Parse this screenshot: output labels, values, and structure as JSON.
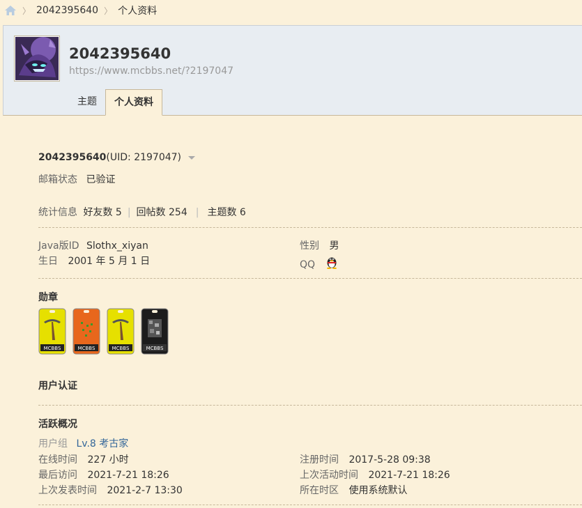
{
  "breadcrumb": {
    "user": "2042395640",
    "page": "个人资料"
  },
  "header": {
    "username": "2042395640",
    "url": "https://www.mcbbs.net/?2197047",
    "tabs": [
      "主题",
      "个人资料"
    ]
  },
  "profile": {
    "name": "2042395640",
    "uid": "(UID: 2197047)",
    "email_label": "邮箱状态",
    "email_value": "已验证",
    "stats_label": "统计信息",
    "stats": [
      {
        "label": "好友数",
        "value": "5"
      },
      {
        "label": "回帖数",
        "value": "254"
      },
      {
        "label": "主题数",
        "value": "6"
      }
    ],
    "java_label": "Java版ID",
    "java_value": "Slothx_xiyan",
    "birthday_label": "生日",
    "birthday_value": "2001 年 5 月 1 日",
    "gender_label": "性别",
    "gender_value": "男",
    "qq_label": "QQ",
    "qq_icon": "qq-penguin-icon"
  },
  "medals": {
    "title": "勋章",
    "items": [
      {
        "name": "pickaxe-medal",
        "color": "#e6e000",
        "text": "MCBBS"
      },
      {
        "name": "redstone-medal",
        "color": "#e8671c",
        "text": "MCBBS"
      },
      {
        "name": "pickaxe-medal",
        "color": "#e6e000",
        "text": "MCBBS"
      },
      {
        "name": "ore-medal",
        "color": "#1c1c1c",
        "text": "MCBBS"
      }
    ]
  },
  "verification": {
    "title": "用户认证"
  },
  "activity": {
    "title": "活跃概况",
    "group_label": "用户组",
    "group_value": "Lv.8 考古家",
    "online_label": "在线时间",
    "online_value": "227 小时",
    "register_label": "注册时间",
    "register_value": "2017-5-28 09:38",
    "last_visit_label": "最后访问",
    "last_visit_value": "2021-7-21 18:26",
    "last_active_label": "上次活动时间",
    "last_active_value": "2021-7-21 18:26",
    "last_post_label": "上次发表时间",
    "last_post_value": "2021-2-7 13:30",
    "timezone_label": "所在时区",
    "timezone_value": "使用系统默认"
  },
  "colors": {
    "link": "#336699",
    "bg": "#fbf1da",
    "header_bg": "#e8edf2"
  }
}
